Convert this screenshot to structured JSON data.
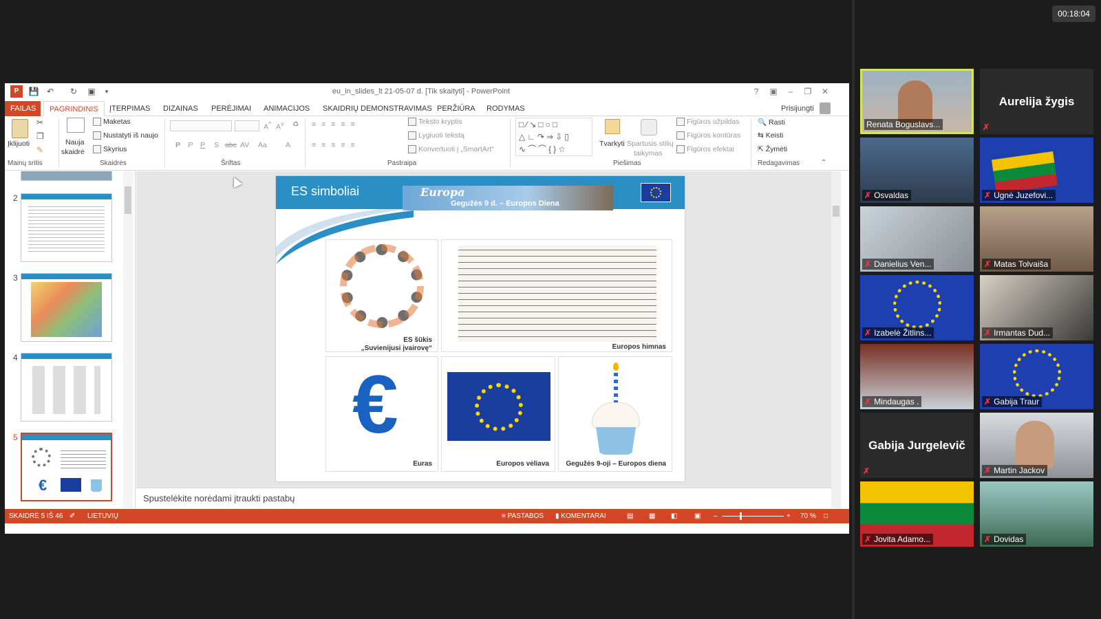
{
  "timer": "00:18:04",
  "window": {
    "title": "eu_in_slides_lt 21-05-07 d. [Tik skaityti] - PowerPoint"
  },
  "tabs": [
    {
      "label": "FAILAS"
    },
    {
      "label": "PAGRINDINIS"
    },
    {
      "label": "ĮTERPIMAS"
    },
    {
      "label": "DIZAINAS"
    },
    {
      "label": "PERĖJIMAI"
    },
    {
      "label": "ANIMACIJOS"
    },
    {
      "label": "SKAIDRIŲ DEMONSTRAVIMAS"
    },
    {
      "label": "PERŽIŪRA"
    },
    {
      "label": "RODYMAS"
    }
  ],
  "signin": "Prisijungti",
  "ribbon": {
    "paste": "Įklijuoti",
    "new_slide_1": "Nauja",
    "new_slide_2": "skaidrė",
    "layout": "Maketas",
    "reset": "Nustatyti iš naujo",
    "section": "Skyrius",
    "text_direction": "Teksto kryptis",
    "align_text": "Lygiuoti tekstą",
    "convert_smartart": "Konvertuoti į „SmartArt“",
    "arrange": "Tvarkyti",
    "quick_styles_1": "Spartusis stilių",
    "quick_styles_2": "taikymas",
    "shape_fill": "Figūros užpildas",
    "shape_outline": "Figūros kontūras",
    "shape_effects": "Figūros efektai",
    "find": "Rasti",
    "replace": "Keisti",
    "select": "Žymėti",
    "bold": "P",
    "italic": "P",
    "underline": "P",
    "shadow": "S",
    "strike": "abc",
    "spacing": "AV",
    "case": "Aa",
    "fontcolor": "A"
  },
  "groups": {
    "clipboard": "Mainų sritis",
    "slides": "Skaidrės",
    "font": "Šriftas",
    "paragraph": "Pastraipa",
    "drawing": "Piešimas",
    "editing": "Redagavimas"
  },
  "thumbs": [
    {
      "num": "2"
    },
    {
      "num": "3"
    },
    {
      "num": "4"
    },
    {
      "num": "5"
    }
  ],
  "slide": {
    "title": "ES simboliai",
    "banner_script": "Europa",
    "banner_text": "Gegužės 9 d. – Europos Diena",
    "cards": {
      "motto_1": "ES šūkis",
      "motto_2": "„Suvienijusi įvairovę“",
      "anthem": "Europos himnas",
      "euro": "Euras",
      "flag": "Europos vėliava",
      "day": "Gegužės 9-oji – Europos diena"
    }
  },
  "notes": "Spustelėkite norėdami įtraukti pastabų",
  "status": {
    "slide": "SKAIDRĖ 5 IŠ 46",
    "language": "LIETUVIŲ",
    "notes": "PASTABOS",
    "comments": "KOMENTARAI",
    "zoom": "70 %"
  },
  "participants": [
    {
      "name": "Renata Boguslavs...",
      "active": true
    },
    {
      "name": "Aurelija žygis",
      "video": false
    },
    {
      "name": "Osvaldas"
    },
    {
      "name": "Ugnė Juzefovi..."
    },
    {
      "name": "Danielius Ven..."
    },
    {
      "name": "Matas Tolvaiša"
    },
    {
      "name": "Izabelė Žitlins..."
    },
    {
      "name": "Irmantas Dud..."
    },
    {
      "name": "Mindaugas ."
    },
    {
      "name": "Gabija Traur"
    },
    {
      "name": "Gabija Jurgelevič",
      "video": false
    },
    {
      "name": "Martin Jackov"
    },
    {
      "name": "Jovita Adamo..."
    },
    {
      "name": "Dovidas"
    }
  ],
  "colors": {
    "accent": "#d24726",
    "slide_header": "#2a8fc4",
    "eu_blue": "#1a3e9e",
    "eu_gold": "#ffd700",
    "active_border": "#d7e55b"
  }
}
